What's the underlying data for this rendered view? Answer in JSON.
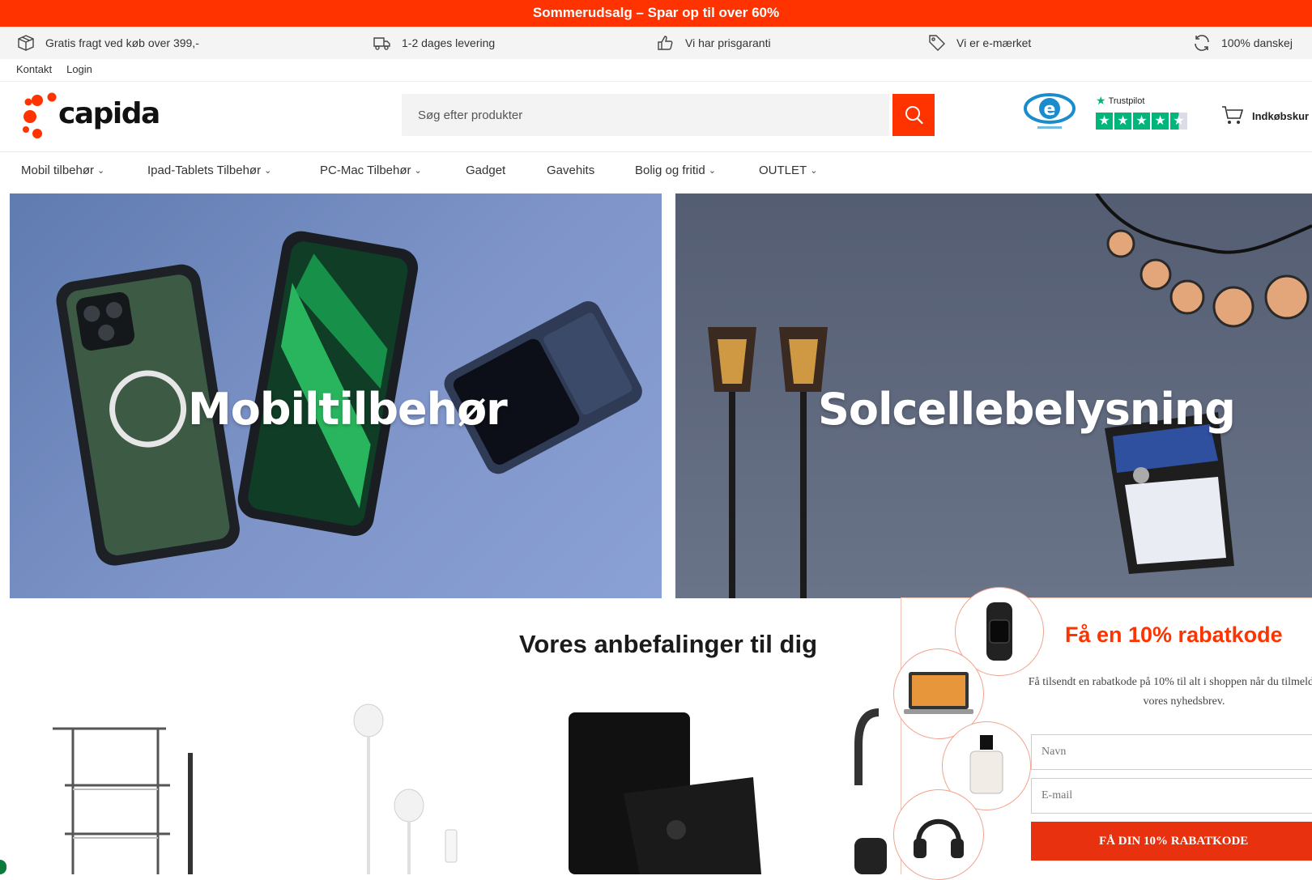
{
  "promo": {
    "text": "Sommerudsalg  –  Spar op til over 60%"
  },
  "usp": [
    {
      "icon": "box-icon",
      "text": "Gratis fragt ved køb over 399,-"
    },
    {
      "icon": "truck-icon",
      "text": "1-2 dages levering"
    },
    {
      "icon": "thumbs-up-icon",
      "text": "Vi har prisgaranti"
    },
    {
      "icon": "tag-icon",
      "text": "Vi er e-mærket"
    },
    {
      "icon": "refresh-icon",
      "text": "100% danskej"
    }
  ],
  "toplinks": {
    "contact": "Kontakt",
    "login": "Login"
  },
  "logo": {
    "text": "capida"
  },
  "search": {
    "placeholder": "Søg efter produkter"
  },
  "trustpilot": {
    "label": "Trustpilot"
  },
  "cart": {
    "label": "Indkøbskur"
  },
  "nav": [
    {
      "label": "Mobil tilbehør",
      "dropdown": true
    },
    {
      "label": "Ipad-Tablets Tilbehør",
      "dropdown": true
    },
    {
      "label": "PC-Mac Tilbehør",
      "dropdown": true
    },
    {
      "label": "Gadget",
      "dropdown": false
    },
    {
      "label": "Gavehits",
      "dropdown": false
    },
    {
      "label": "Bolig og fritid",
      "dropdown": true
    },
    {
      "label": "OUTLET",
      "dropdown": true
    }
  ],
  "banners": {
    "left": {
      "title": "Mobiltilbehør"
    },
    "right": {
      "title": "Solcellebelysning"
    }
  },
  "recommendations": {
    "title": "Vores anbefalinger til dig"
  },
  "popup": {
    "title": "Få en 10% rabatkode",
    "text": "Få tilsendt en rabatkode på 10% til alt i shoppen når du tilmelder dig vores nyhedsbrev.",
    "name_placeholder": "Navn",
    "email_placeholder": "E-mail",
    "button": "FÅ DIN 10% RABATKODE"
  },
  "colors": {
    "brand": "#ff3300",
    "trustpilot": "#00b67a",
    "emark": "#1a8ccd"
  }
}
